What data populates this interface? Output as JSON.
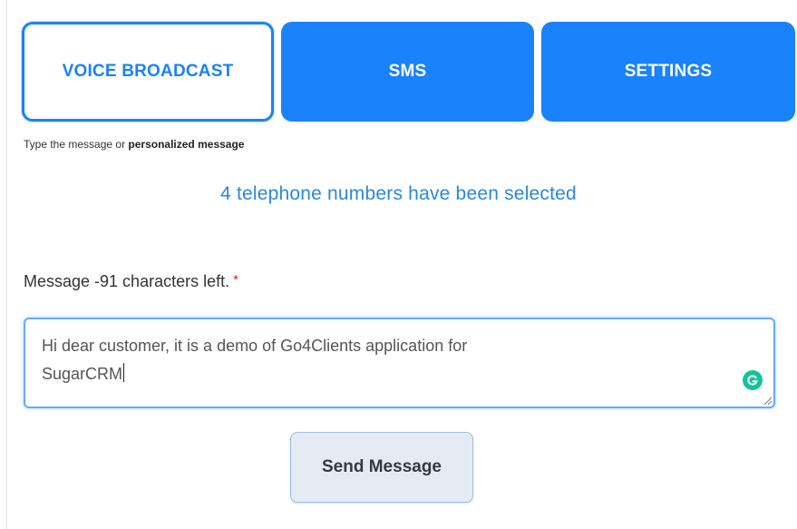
{
  "tabs": [
    {
      "label": "VOICE BROADCAST",
      "active": true
    },
    {
      "label": "SMS",
      "active": false
    },
    {
      "label": "SETTINGS",
      "active": false
    }
  ],
  "hint": {
    "prefix": "Type the message or ",
    "bold": "personalized message"
  },
  "selected_count_text": "4 telephone numbers have been selected",
  "message": {
    "label": "Message -91 characters left.",
    "required_mark": "*",
    "value": "Hi dear customer, it is a demo of Go4Clients application for\nSugarCRM"
  },
  "send_button_label": "Send Message",
  "colors": {
    "accent": "#1a82fb",
    "info_text": "#2b87d9",
    "required": "#e0202a",
    "grammarly": "#15c39a"
  },
  "icons": [
    "grammarly-icon",
    "resize-handle-icon"
  ]
}
